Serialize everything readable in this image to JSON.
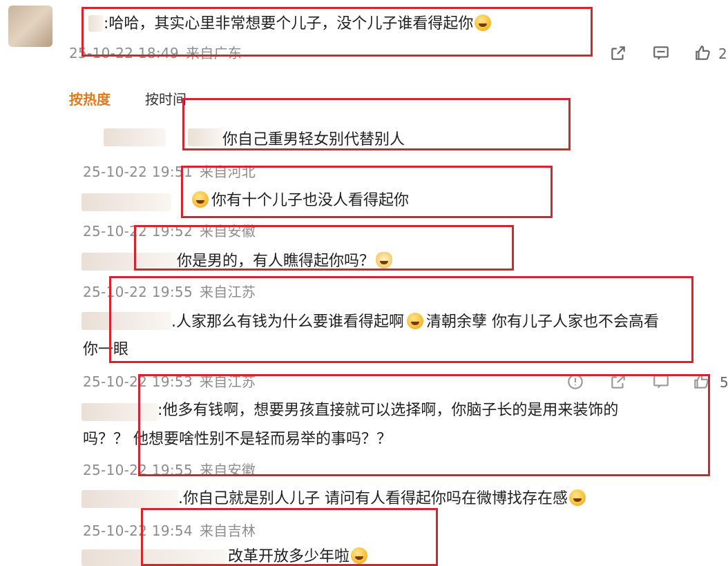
{
  "top_comment": {
    "text": ":哈哈，其实心里非常想要个儿子，没个儿子谁看得起你",
    "meta_date": "25-10-22 18:49",
    "meta_loc": "来自广东",
    "like_count": "2"
  },
  "sort_tabs": {
    "hot": "按热度",
    "time": "按时间"
  },
  "replies": [
    {
      "text": "你自己重男轻女别代替别人",
      "meta_date": "25-10-22 19:51",
      "meta_loc": "来自河北"
    },
    {
      "text": "你有十个儿子也没人看得起你",
      "meta_date": "25-10-22 19:52",
      "meta_loc": "来自安徽"
    },
    {
      "text": "你是男的，有人瞧得起你吗？",
      "meta_date": "25-10-22 19:55",
      "meta_loc": "来自江苏"
    },
    {
      "text_line1": ".人家那么有钱为什么要谁看得起啊",
      "text_line1b": "清朝余孽 你有儿子人家也不会高看",
      "text_line2": "你一眼",
      "meta_date": "25-10-22 19:53",
      "meta_loc": "来自江苏",
      "like_count": "5"
    },
    {
      "text_line1": ":他多有钱啊，想要男孩直接就可以选择啊，你脑子长的是用来装饰的",
      "text_line2": "吗？？ 他想要啥性别不是轻而易举的事吗？？",
      "meta_date": "25-10-22 19:55",
      "meta_loc": "来自安徽"
    },
    {
      "text": ".你自己就是别人儿子 请问有人看得起你吗在微博找存在感",
      "meta_date": "25-10-22 19:54",
      "meta_loc": "来自吉林"
    },
    {
      "text": "改革开放多少年啦"
    }
  ]
}
